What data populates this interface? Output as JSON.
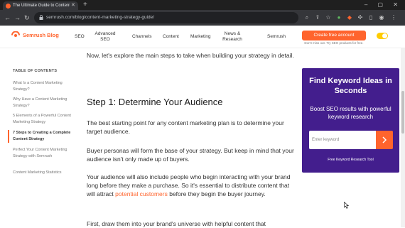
{
  "browser": {
    "tab_title": "The Ultimate Guide to Content...",
    "tab_close": "✕",
    "new_tab": "+",
    "window_controls": "–  ▢  ✕",
    "url": "semrush.com/blog/content-marketing-strategy-guide/"
  },
  "header": {
    "logo": "Semrush Blog",
    "nav": [
      "SEO",
      "Advanced SEO",
      "Channels",
      "Content",
      "Marketing",
      "News & Research"
    ],
    "semrush_link": "Semrush",
    "cta_label": "Create free account",
    "cta_subtext": "Don't miss out. Try SEO products for free."
  },
  "toc": {
    "title": "TABLE OF CONTENTS",
    "items": [
      "What Is a Content Marketing Strategy?",
      "Why Have a Content Marketing Strategy?",
      "5 Elements of a Powerful Content Marketing Strategy",
      "7 Steps to Creating a Complete Content Strategy",
      "Perfect Your Content Marketing Strategy with Semrush",
      "Content Marketing Statistics"
    ],
    "active_index": 3
  },
  "article": {
    "intro": "Now, let's explore the main steps to take when building your strategy in detail.",
    "heading": "Step 1: Determine Your Audience",
    "p1": "The best starting point for any content marketing plan is to determine your target audience.",
    "p2": "Buyer personas will form the base of your strategy. But keep in mind that your audience isn't only made up of buyers.",
    "p3_before": "Your audience will also include people who begin interacting with your brand long before they make a purchase. So it's essential to distribute content that will attract ",
    "p3_link": "potential customers",
    "p3_after": " before they begin the buyer journey.",
    "p4": "First, draw them into your brand's universe with helpful content that"
  },
  "promo": {
    "title": "Find Keyword Ideas in Seconds",
    "body": "Boost SEO results with powerful keyword research",
    "input_placeholder": "Enter keyword",
    "link": "Free Keyword Research Tool"
  },
  "colors": {
    "brand": "#ff642d",
    "promo_bg": "#431e8d"
  }
}
